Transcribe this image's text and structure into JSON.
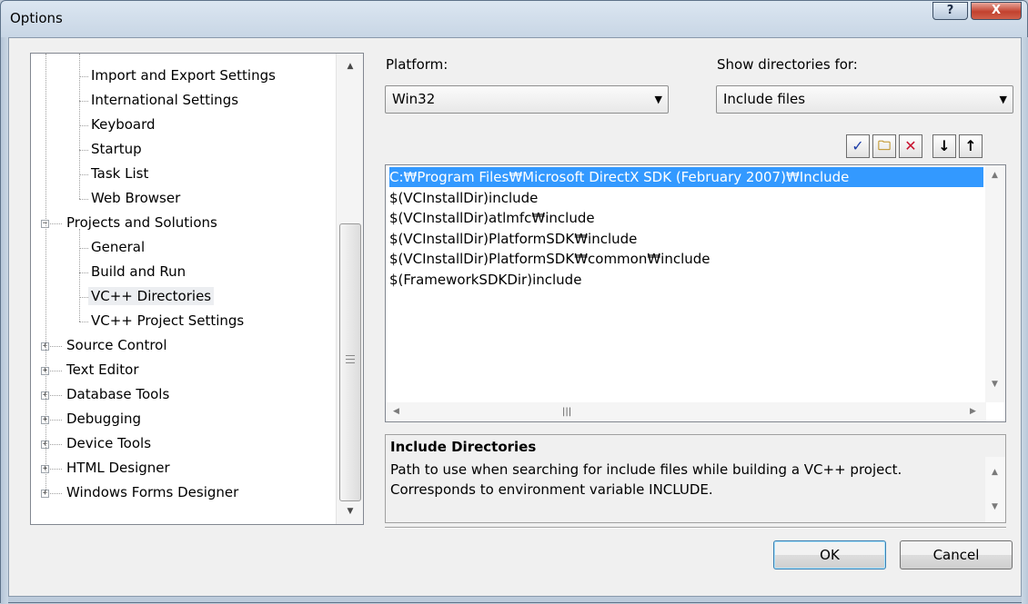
{
  "window": {
    "title": "Options",
    "help_label": "?",
    "close_label": "X"
  },
  "tree": {
    "items": [
      {
        "label": "Import and Export Settings",
        "level": 2
      },
      {
        "label": "International Settings",
        "level": 2
      },
      {
        "label": "Keyboard",
        "level": 2
      },
      {
        "label": "Startup",
        "level": 2
      },
      {
        "label": "Task List",
        "level": 2
      },
      {
        "label": "Web Browser",
        "level": 2
      },
      {
        "label": "Projects and Solutions",
        "level": 1,
        "expanded": true
      },
      {
        "label": "General",
        "level": 2
      },
      {
        "label": "Build and Run",
        "level": 2
      },
      {
        "label": "VC++ Directories",
        "level": 2,
        "selected": true
      },
      {
        "label": "VC++ Project Settings",
        "level": 2
      },
      {
        "label": "Source Control",
        "level": 1,
        "expanded": false
      },
      {
        "label": "Text Editor",
        "level": 1,
        "expanded": false
      },
      {
        "label": "Database Tools",
        "level": 1,
        "expanded": false
      },
      {
        "label": "Debugging",
        "level": 1,
        "expanded": false
      },
      {
        "label": "Device Tools",
        "level": 1,
        "expanded": false
      },
      {
        "label": "HTML Designer",
        "level": 1,
        "expanded": false
      },
      {
        "label": "Windows Forms Designer",
        "level": 1,
        "expanded": false
      }
    ]
  },
  "platform": {
    "label": "Platform:",
    "value": "Win32"
  },
  "show_directories": {
    "label": "Show directories for:",
    "value": "Include files"
  },
  "toolbar": {
    "buttons": [
      {
        "name": "check-icon",
        "glyph": "✓"
      },
      {
        "name": "new-folder-icon",
        "glyph": "🗀"
      },
      {
        "name": "delete-icon",
        "glyph": "✕"
      },
      {
        "name": "move-down-icon",
        "glyph": "↓"
      },
      {
        "name": "move-up-icon",
        "glyph": "↑"
      }
    ]
  },
  "directories": [
    "C:₩Program Files₩Microsoft DirectX SDK (February 2007)₩Include",
    "$(VCInstallDir)include",
    "$(VCInstallDir)atlmfc₩include",
    "$(VCInstallDir)PlatformSDK₩include",
    "$(VCInstallDir)PlatformSDK₩common₩include",
    "$(FrameworkSDKDir)include"
  ],
  "description": {
    "title": "Include Directories",
    "text": "Path to use when searching for include files while building a VC++ project. Corresponds to environment variable INCLUDE."
  },
  "buttons": {
    "ok": "OK",
    "cancel": "Cancel"
  },
  "colors": {
    "selection": "#3399ff",
    "title_close": "#c2412e"
  }
}
